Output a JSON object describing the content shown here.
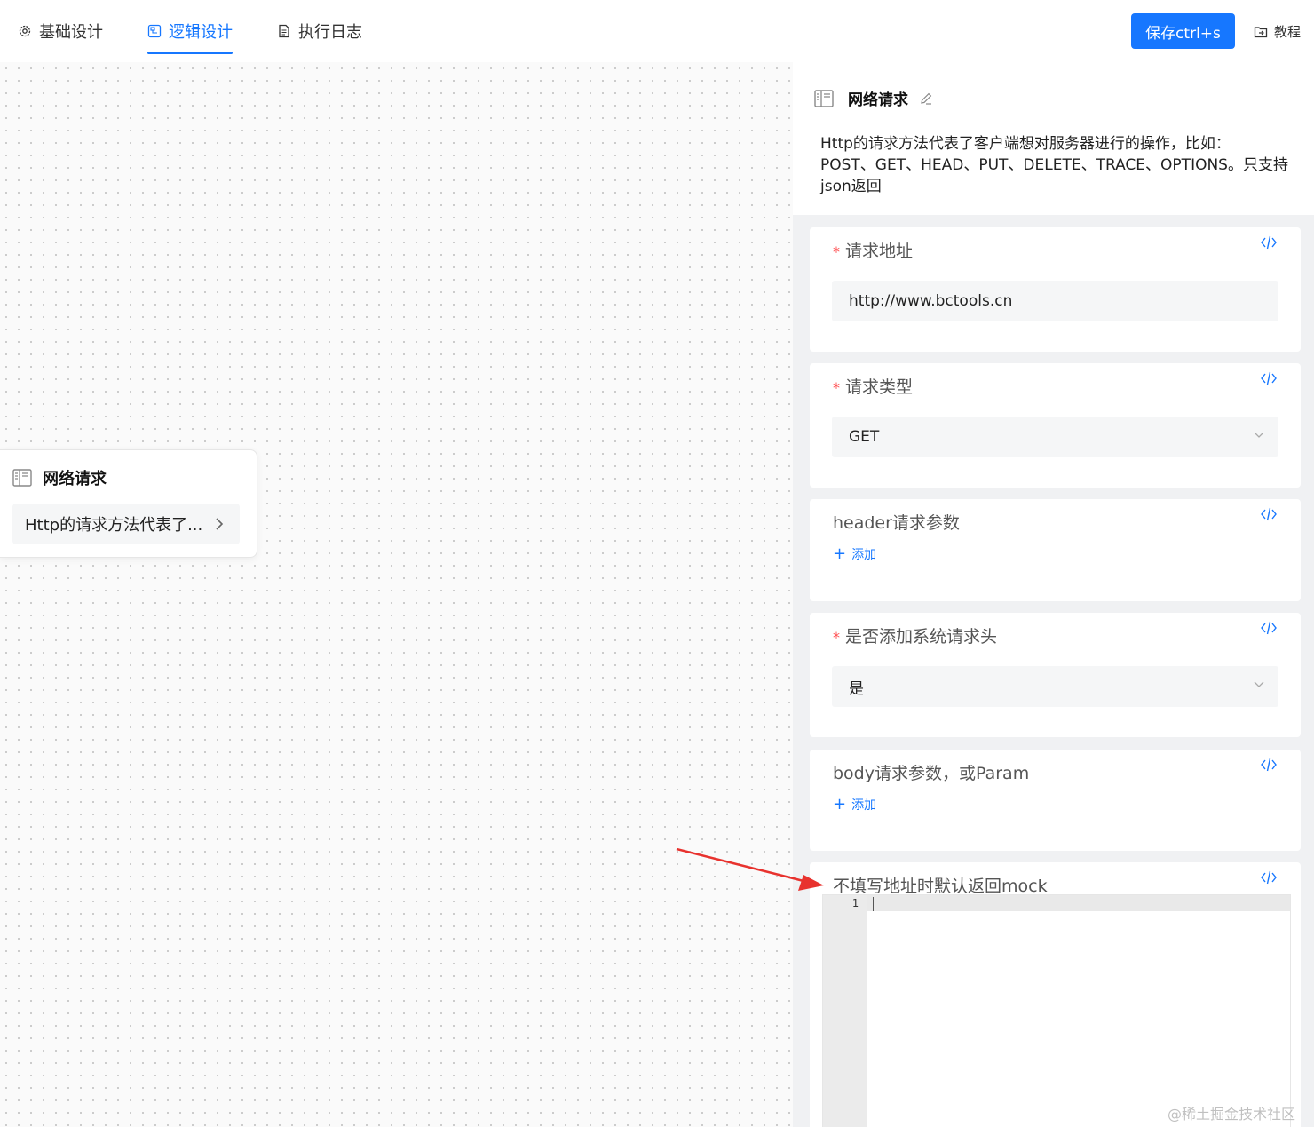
{
  "tabs": [
    {
      "label": "基础设计",
      "icon": "gear-icon"
    },
    {
      "label": "逻辑设计",
      "icon": "flow-icon",
      "active": true
    },
    {
      "label": "执行日志",
      "icon": "document-icon"
    }
  ],
  "toolbar": {
    "save_label": "保存ctrl+s",
    "tutorial_label": "教程",
    "tutorial_icon": "folder-export-icon",
    "accent_color": "#1677ff"
  },
  "node": {
    "title": "网络请求",
    "desc": "Http的请求方法代表了...",
    "icon": "sidebar-panel-icon"
  },
  "panel": {
    "title": "网络请求",
    "edit_icon": "pencil-icon",
    "desc_lines": [
      "Http的请求方法代表了客户端想对服务器进行的操作，比如：",
      "POST、GET、HEAD、PUT、DELETE、TRACE、OPTIONS。只支持",
      "json返回"
    ],
    "fields": {
      "url": {
        "label": "请求地址",
        "required": "*",
        "value": "http://www.bctools.cn"
      },
      "method": {
        "label": "请求类型",
        "required": "*",
        "value": "GET"
      },
      "headers": {
        "label": "header请求参数",
        "add_label": "添加"
      },
      "system_header": {
        "label": "是否添加系统请求头",
        "required": "*",
        "value": "是"
      },
      "body": {
        "label": "body请求参数，或Param",
        "add_label": "添加"
      },
      "mock": {
        "label": "不填写地址时默认返回mock",
        "line_number": "1"
      }
    }
  },
  "watermark": "@稀土掘金技术社区",
  "annotation_color": "#e8322e"
}
